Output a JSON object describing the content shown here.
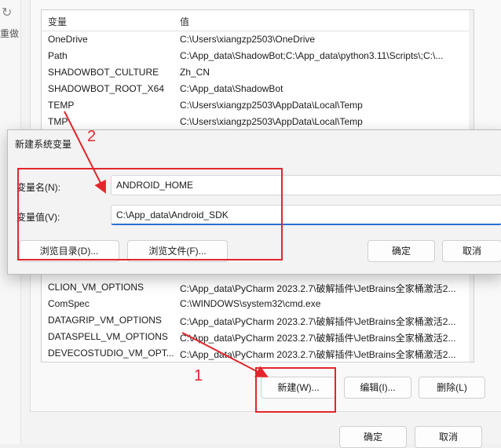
{
  "background": {
    "redo_label": "重做",
    "list": {
      "headers": [
        "变量",
        "值"
      ],
      "rows_top": [
        {
          "name": "OneDrive",
          "value": "C:\\Users\\xiangzp2503\\OneDrive"
        },
        {
          "name": "Path",
          "value": "C:\\App_data\\ShadowBot;C:\\App_data\\python3.11\\Scripts\\;C:\\..."
        },
        {
          "name": "SHADOWBOT_CULTURE",
          "value": "Zh_CN"
        },
        {
          "name": "SHADOWBOT_ROOT_X64",
          "value": "C:\\App_data\\ShadowBot"
        },
        {
          "name": "TEMP",
          "value": "C:\\Users\\xiangzp2503\\AppData\\Local\\Temp"
        },
        {
          "name": "TMP",
          "value": "C:\\Users\\xiangzp2503\\AppData\\Local\\Temp"
        }
      ],
      "rows_bottom": [
        {
          "name": "CLION_VM_OPTIONS",
          "value": "C:\\App_data\\PyCharm 2023.2.7\\破解插件\\JetBrains全家桶激活2..."
        },
        {
          "name": "ComSpec",
          "value": "C:\\WINDOWS\\system32\\cmd.exe"
        },
        {
          "name": "DATAGRIP_VM_OPTIONS",
          "value": "C:\\App_data\\PyCharm 2023.2.7\\破解插件\\JetBrains全家桶激活2..."
        },
        {
          "name": "DATASPELL_VM_OPTIONS",
          "value": "C:\\App_data\\PyCharm 2023.2.7\\破解插件\\JetBrains全家桶激活2..."
        },
        {
          "name": "DEVECOSTUDIO_VM_OPT...",
          "value": "C:\\App_data\\PyCharm 2023.2.7\\破解插件\\JetBrains全家桶激活2..."
        }
      ]
    },
    "buttons": {
      "new": "新建(W)...",
      "edit": "编辑(I)...",
      "delete": "删除(L)",
      "ok": "确定",
      "cancel": "取消"
    }
  },
  "dialog": {
    "title": "新建系统变量",
    "name_label": "变量名(N):",
    "name_value": "ANDROID_HOME",
    "value_label": "变量值(V):",
    "value_value": "C:\\App_data\\Android_SDK",
    "browse_dir": "浏览目录(D)...",
    "browse_file": "浏览文件(F)...",
    "ok": "确定",
    "cancel": "取消"
  },
  "annotations": {
    "step1": "1",
    "step2": "2",
    "color": "#e3262b"
  }
}
